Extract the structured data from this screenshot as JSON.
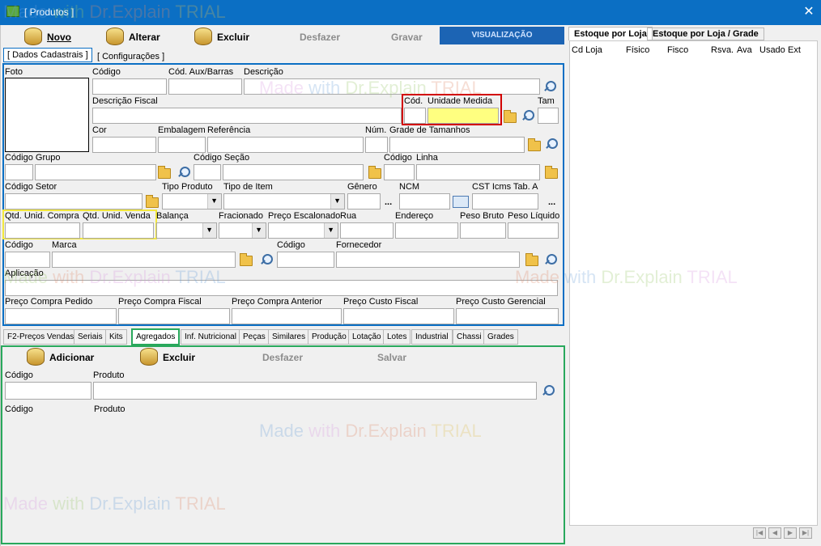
{
  "window": {
    "title": "[ Produtos ]"
  },
  "toolbar": {
    "novo": "Novo",
    "alterar": "Alterar",
    "excluir": "Excluir",
    "desfazer": "Desfazer",
    "gravar": "Gravar",
    "visualizacao": "VISUALIZAÇÃO"
  },
  "tabs": {
    "dados": "[ Dados Cadastrais ]",
    "config": "[ Configurações ]"
  },
  "labels": {
    "foto": "Foto",
    "codigo": "Código",
    "cod_aux": "Cód. Aux/Barras",
    "descricao": "Descrição",
    "descricao_fiscal": "Descrição Fiscal",
    "cod": "Cód.",
    "unidade_medida": "Unidade Medida",
    "tam": "Tam",
    "cor": "Cor",
    "embalagem": "Embalagem",
    "referencia": "Referência",
    "num": "Núm.",
    "grade_tamanhos": "Grade de Tamanhos",
    "codigo_grupo": "Código Grupo",
    "codigo_secao": "Código Seção",
    "codigo_linha_cod": "Código",
    "linha": "Linha",
    "codigo_setor": "Código Setor",
    "tipo_produto": "Tipo Produto",
    "tipo_item": "Tipo de Item",
    "genero": "Gênero",
    "ncm": "NCM",
    "cst_icms": "CST Icms Tab. A",
    "qtd_unid_compra": "Qtd. Unid. Compra",
    "qtd_unid_venda": "Qtd. Unid. Venda",
    "balanca": "Balança",
    "fracionado": "Fracionado",
    "preco_escalonado": "Preço Escalonado",
    "rua": "Rua",
    "endereco": "Endereço",
    "peso_bruto": "Peso Bruto",
    "peso_liquido": "Peso Líquido",
    "codigo_marca": "Código",
    "marca": "Marca",
    "codigo_fornecedor": "Código",
    "fornecedor": "Fornecedor",
    "aplicacao": "Aplicação",
    "preco_compra_pedido": "Preço Compra Pedido",
    "preco_compra_fiscal": "Preço Compra Fiscal",
    "preco_compra_anterior": "Preço Compra Anterior",
    "preco_custo_fiscal": "Preço Custo Fiscal",
    "preco_custo_gerencial": "Preço Custo Gerencial",
    "dots": "..."
  },
  "subtabs": [
    "F2-Preços Vendas",
    "Seriais",
    "Kits",
    "Agregados",
    "Inf. Nutricional",
    "Peças",
    "Similares",
    "Produção",
    "Lotação",
    "Lotes",
    "Industrial",
    "Chassi",
    "Grades"
  ],
  "agregados": {
    "adicionar": "Adicionar",
    "excluir": "Excluir",
    "desfazer": "Desfazer",
    "salvar": "Salvar",
    "codigo": "Código",
    "produto": "Produto",
    "grid_codigo": "Código",
    "grid_produto": "Produto"
  },
  "estoque": {
    "tab1": "Estoque por Loja",
    "tab2": "Estoque por Loja / Grade",
    "cols": [
      "Cd Loja",
      "Físico",
      "Fisco",
      "Rsva.",
      "Ava",
      "Usado",
      "Ext"
    ]
  },
  "watermark": [
    "Made",
    "with",
    "Dr.Explain",
    "TRIAL"
  ],
  "colors": {
    "titlebar": "#0b6fc4",
    "panel_border": "#0b6fc4",
    "agregados_border": "#29a85c",
    "highlight_red": "#d20000",
    "highlight_yellow": "#f3e83d",
    "field_yellow": "#ffff80"
  }
}
